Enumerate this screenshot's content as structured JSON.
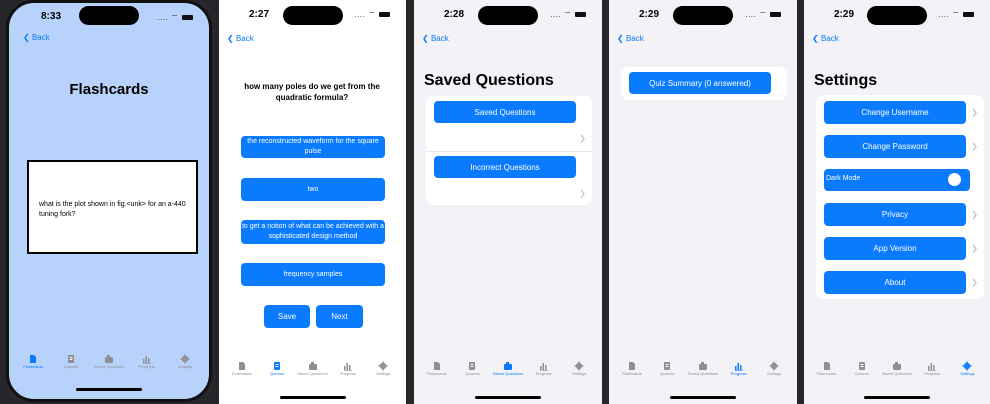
{
  "common": {
    "back_label": "Back",
    "status_dots": "....",
    "tabs": [
      "Flashcards",
      "Quizzes",
      "Saved Questions",
      "Progress",
      "Settings"
    ],
    "colors": {
      "accent": "#0a7aff",
      "flashcard_bg": "#b8d3fb",
      "grouped_bg": "#f2f2f7"
    }
  },
  "screens": [
    {
      "time": "8:33",
      "title": "Flashcards",
      "card_text": "what is the plot shown in fig.<unk> for an a-440 tuning fork?",
      "active_tab": 0
    },
    {
      "time": "2:27",
      "question": "how many poles do we get from the quadratic formula?",
      "answers": [
        "the reconstructed waveform for the square pulse",
        "two",
        "to get a notion of what can be achieved with a sophisticated design method",
        "frequency samples"
      ],
      "save_label": "Save",
      "next_label": "Next",
      "active_tab": 1
    },
    {
      "time": "2:28",
      "title": "Saved Questions",
      "buttons": [
        "Saved Questions",
        "Incorrect Questions"
      ],
      "active_tab": 2
    },
    {
      "time": "2:29",
      "summary_label": "Quiz Summary (0 answered)",
      "active_tab": 3
    },
    {
      "time": "2:29",
      "title": "Settings",
      "items": [
        "Change Username",
        "Change Password",
        "Dark Mode",
        "Privacy",
        "App Version",
        "About"
      ],
      "dark_mode_on": true,
      "active_tab": 4
    }
  ]
}
